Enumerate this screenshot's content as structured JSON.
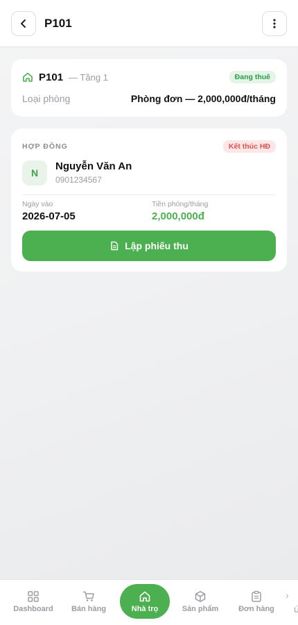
{
  "header": {
    "title": "P101",
    "back_icon": "chevron-left-icon",
    "menu_icon": "more-vertical-icon"
  },
  "room": {
    "name": "P101",
    "floor": "— Tầng 1",
    "status": "Đang thuê",
    "type_label": "Loại phòng",
    "type_value": "Phòng đơn — 2,000,000đ/tháng"
  },
  "contract": {
    "section_label": "HỢP ĐỒNG",
    "end_button": "Kết thúc HĐ",
    "tenant_initial": "N",
    "tenant_name": "Nguyễn Văn An",
    "tenant_phone": "0901234567",
    "start_label": "Ngày vào",
    "start_value": "2026-07-05",
    "rent_label": "Tiền phòng/tháng",
    "rent_value": "2,000,000đ",
    "receipt_button": "Lập phiếu thu"
  },
  "nav": {
    "items": [
      {
        "label": "Dashboard",
        "icon": "grid-icon"
      },
      {
        "label": "Bán hàng",
        "icon": "cart-icon"
      },
      {
        "label": "Nhà trọ",
        "icon": "home-icon"
      },
      {
        "label": "Sản phẩm",
        "icon": "box-icon"
      },
      {
        "label": "Đơn hàng",
        "icon": "clipboard-icon"
      }
    ],
    "active": "Nhà trọ",
    "more_glyph": "›",
    "edge_label": "Ứ"
  },
  "colors": {
    "accent": "#4caf50",
    "status_green_bg": "#e4f5e8",
    "danger_bg": "#fde6e6",
    "danger_text": "#d9534f"
  }
}
